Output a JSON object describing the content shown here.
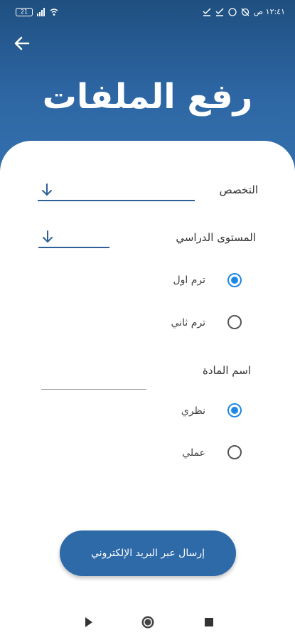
{
  "status_bar": {
    "time": "١٢:٤١ ص",
    "battery": "21"
  },
  "header": {
    "title": "رفع الملفات"
  },
  "form": {
    "specialization_label": "التخصص",
    "level_label": "المستوى الدراسي",
    "term_options": [
      {
        "label": "ترم اول",
        "checked": true
      },
      {
        "label": "ترم ثاني",
        "checked": false
      }
    ],
    "subject_label": "اسم المادة",
    "type_options": [
      {
        "label": "نظري",
        "checked": true
      },
      {
        "label": "عملي",
        "checked": false
      }
    ]
  },
  "actions": {
    "send_email_label": "إرسال عبر البريد الإلكتروني"
  },
  "colors": {
    "header_bg": "#2d66a3",
    "accent": "#1e88e5",
    "button_bg": "#2e69a8"
  }
}
